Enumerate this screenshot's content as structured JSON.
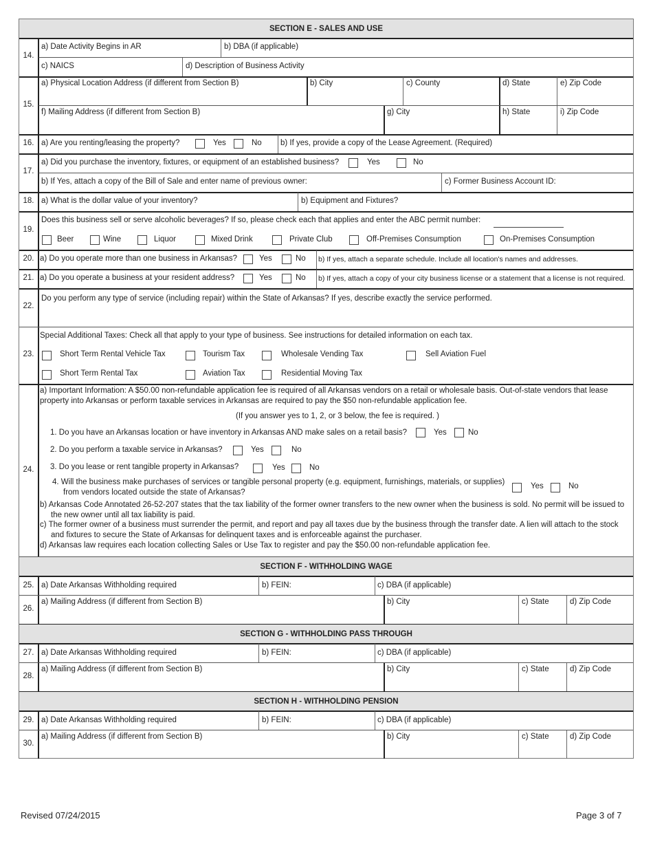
{
  "sections": {
    "e": "SECTION E - SALES AND USE",
    "f": "SECTION F - WITHHOLDING WAGE",
    "g": "SECTION G -  WITHHOLDING PASS THROUGH",
    "h": "SECTION H - WITHHOLDING PENSION"
  },
  "q14": {
    "num": "14.",
    "a": "a) Date Activity Begins in AR",
    "b": "b) DBA (if applicable)",
    "c": "c) NAICS",
    "d": "d) Description of Business Activity"
  },
  "q15": {
    "num": "15.",
    "a": "a) Physical Location Address (if different from Section B)",
    "b": "b) City",
    "c": "c) County",
    "d": "d) State",
    "e": "e) Zip Code",
    "f": "f) Mailing Address (if different from Section B)",
    "g": "g) City",
    "h": "h) State",
    "i": "i) Zip Code"
  },
  "q16": {
    "num": "16.",
    "a": "a) Are you renting/leasing the property?",
    "yes": "Yes",
    "no": "No",
    "b": "b) If yes, provide a copy of the Lease Agreement. (Required)"
  },
  "q17": {
    "num": "17.",
    "a": "a) Did you purchase the inventory, fixtures, or equipment of an established business?",
    "yes": "Yes",
    "no": "No",
    "b": "b) If Yes, attach a copy of the Bill of Sale and enter name of previous owner:",
    "c": "c) Former Business Account ID:"
  },
  "q18": {
    "num": "18.",
    "a": "a) What is the dollar value of your inventory?",
    "b": "b) Equipment and Fixtures?"
  },
  "q19": {
    "num": "19.",
    "text": "Does this business sell or serve alcoholic beverages?  If so, please check each that applies and enter the ABC permit number:",
    "options": [
      "Beer",
      "Wine",
      "Liquor",
      "Mixed Drink",
      "Private Club",
      "Off-Premises Consumption",
      "On-Premises Consumption"
    ]
  },
  "q20": {
    "num": "20.",
    "a": "a) Do you operate more than one business in Arkansas?",
    "yes": "Yes",
    "no": "No",
    "b": "b) If yes, attach a separate schedule.  Include all location's names and addresses."
  },
  "q21": {
    "num": "21.",
    "a": "a) Do you operate a business at your resident address?",
    "yes": "Yes",
    "no": "No",
    "b": "b) If yes, attach a copy of your city business license or a statement that a license is not required."
  },
  "q22": {
    "num": "22.",
    "text": "Do you perform any type of service (including repair) within the State of Arkansas?  If yes, describe exactly the service performed."
  },
  "q23": {
    "num": "23.",
    "text": "Special Additional Taxes:  Check all that apply to your type of business.  See instructions for detailed information on each tax.",
    "options": [
      "Short Term Rental Vehicle Tax",
      "Tourism Tax",
      "Wholesale Vending Tax",
      "Sell Aviation Fuel",
      "Short Term Rental Tax",
      "Aviation Tax",
      "Residential Moving Tax"
    ]
  },
  "q24": {
    "num": "24.",
    "a": "a) Important Information: A $50.00 non-refundable application fee is required of all Arkansas vendors on a retail or wholesale basis.  Out-of-state vendors that lease property into Arkansas or perform taxable services in Arkansas are required to pay the $50 non-refundable application fee.",
    "note": "(If you answer yes to 1, 2, or 3 below, the fee is required. )",
    "q1": "1.  Do you have an Arkansas location or have inventory in Arkansas AND make sales on a retail basis?",
    "q2": "2.  Do you perform a taxable service in Arkansas?",
    "q3": "3.  Do you lease or rent tangible property in Arkansas?",
    "q4": "4. Will the business make purchases of services or tangible personal property (e.g. equipment, furnishings, materials, or supplies) from vendors located outside the state of Arkansas?",
    "yes": "Yes",
    "no": "No",
    "b": "b) Arkansas Code Annotated 26-52-207 states that the tax liability of the former owner transfers to the new owner when the business is sold.  No permit will be issued to the new owner until all tax liability is paid.",
    "c": "c) The former owner of a business must surrender the permit, and report and pay all taxes due by the business through the transfer date.  A lien will attach to the stock and fixtures to secure the State of Arkansas for delinquent taxes and is enforceable against the purchaser.",
    "d": "d) Arkansas law requires each location collecting Sales or Use Tax to register and pay the $50.00 non-refundable application fee."
  },
  "withholding": {
    "date": "a) Date Arkansas Withholding required",
    "fein": "b) FEIN:",
    "dba": "c) DBA (if applicable)",
    "mailing": "a) Mailing Address (if different from Section B)",
    "city": "b) City",
    "state": "c) State",
    "zip": "d) Zip Code"
  },
  "nums": {
    "n25": "25.",
    "n26": "26.",
    "n27": "27.",
    "n28": "28.",
    "n29": "29.",
    "n30": "30."
  },
  "footer": {
    "revised": "Revised  07/24/2015",
    "page": "Page 3 of 7"
  }
}
